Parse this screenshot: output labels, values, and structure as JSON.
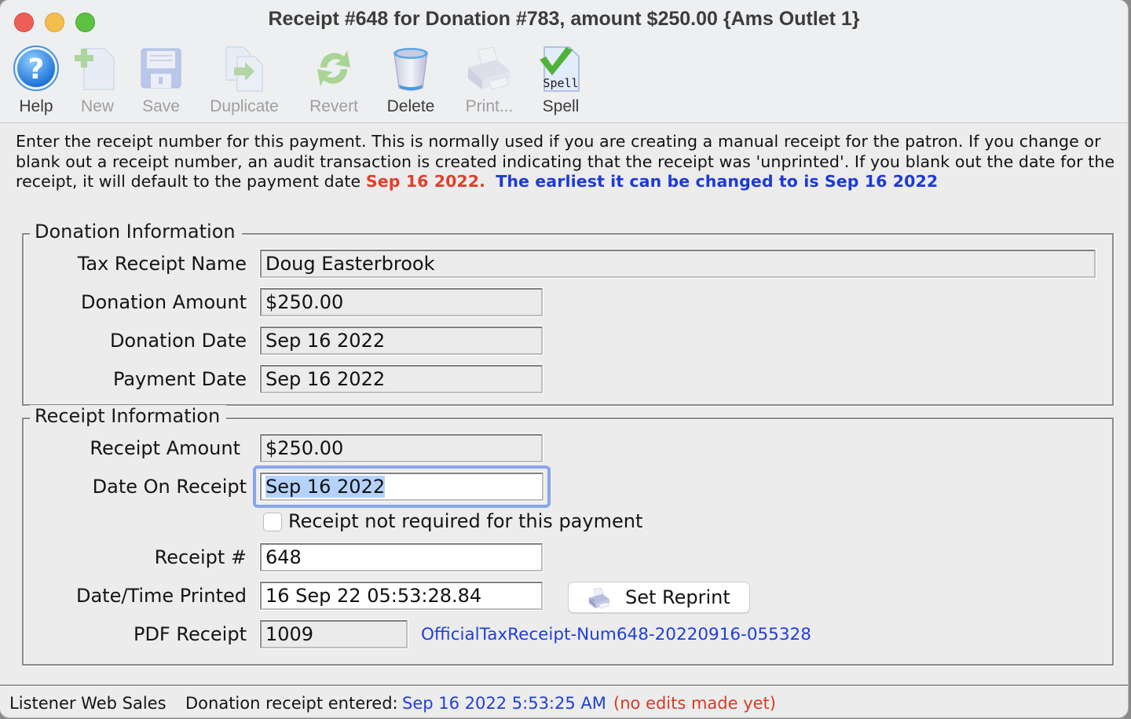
{
  "window": {
    "title": "Receipt #648 for Donation #783, amount $250.00 {Ams Outlet 1}"
  },
  "toolbar": {
    "items": [
      {
        "label": "Help",
        "icon": "help-icon",
        "enabled": true
      },
      {
        "label": "New",
        "icon": "new-document-icon",
        "enabled": false
      },
      {
        "label": "Save",
        "icon": "save-disk-icon",
        "enabled": false
      },
      {
        "label": "Duplicate",
        "icon": "duplicate-icon",
        "enabled": false
      },
      {
        "label": "Revert",
        "icon": "revert-icon",
        "enabled": false
      },
      {
        "label": "Delete",
        "icon": "trash-bin-icon",
        "enabled": true
      },
      {
        "label": "Print...",
        "icon": "printer-icon",
        "enabled": false
      },
      {
        "label": "Spell",
        "icon": "spell-check-icon",
        "enabled": true
      }
    ]
  },
  "info": {
    "line_text": "Enter the receipt number for this payment.  This is normally used if you are creating a manual receipt for the patron.  If you change or blank out a receipt number, an audit transaction is created indicating that the receipt was 'unprinted'.  If you blank out the date for the receipt, it will default to the payment date ",
    "payment_date_highlight": "Sep 16 2022.",
    "earliest_note": "The earliest it can be changed to is Sep 16 2022",
    "colors": {
      "red": "#e0402a",
      "blue": "#1d3ad6"
    }
  },
  "donation_info": {
    "legend": "Donation Information",
    "tax_receipt_name_label": "Tax Receipt Name",
    "tax_receipt_name": "Doug Easterbrook",
    "donation_amount_label": "Donation Amount",
    "donation_amount": "$250.00",
    "donation_date_label": "Donation Date",
    "donation_date": "Sep 16 2022",
    "payment_date_label": "Payment Date",
    "payment_date": "Sep 16 2022"
  },
  "receipt_info": {
    "legend": "Receipt Information",
    "receipt_amount_label": "Receipt Amount",
    "receipt_amount": "$250.00",
    "date_on_receipt_label": "Date On Receipt",
    "date_on_receipt": "Sep 16 2022",
    "not_required_label": "Receipt not required for this payment",
    "not_required_checked": false,
    "receipt_number_label": "Receipt #",
    "receipt_number": "648",
    "date_time_printed_label": "Date/Time Printed",
    "date_time_printed": "16 Sep 22  05:53:28.84",
    "set_reprint_label": "Set Reprint",
    "pdf_receipt_label": "PDF Receipt",
    "pdf_receipt": "1009",
    "pdf_link": "OfficialTaxReceipt-Num648-20220916-055328"
  },
  "status": {
    "source": "Listener Web Sales",
    "entered_label": "Donation receipt entered:",
    "entered_time": "Sep 16 2022 5:53:25 AM",
    "edits_note": "(no edits made yet)",
    "colors": {
      "time": "#1f3fd8",
      "note": "#d83a26"
    }
  }
}
